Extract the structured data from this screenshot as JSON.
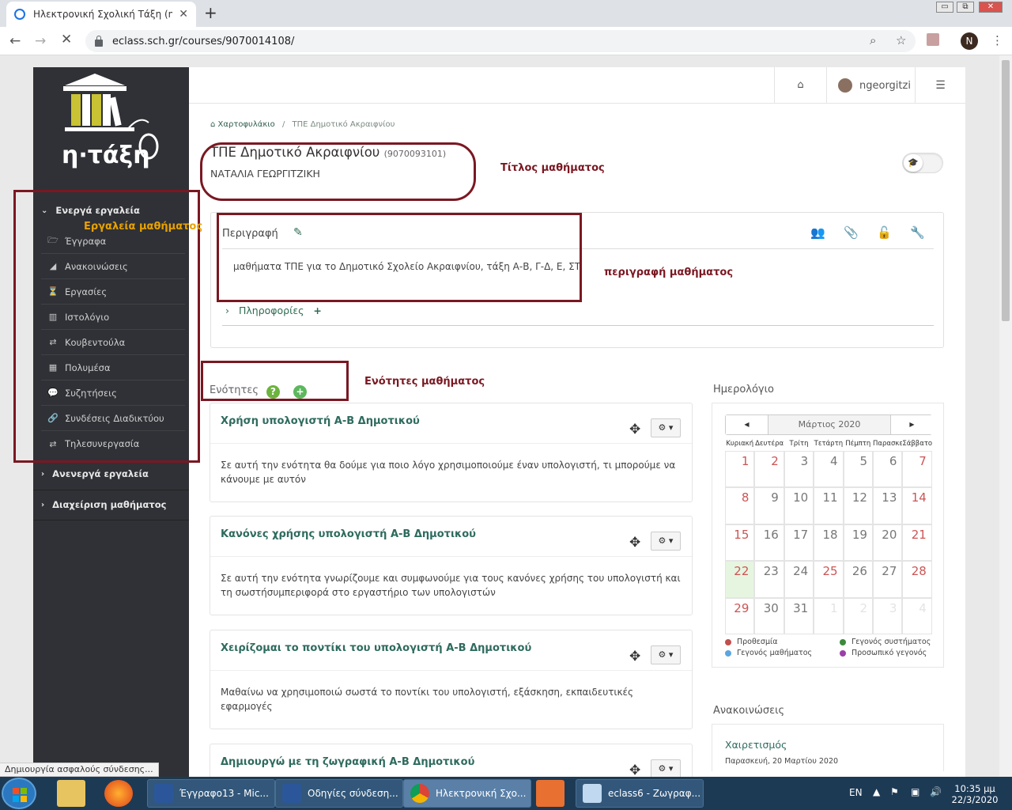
{
  "browser": {
    "tab_title": "Ηλεκτρονική Σχολική Τάξη (η-Τά",
    "tab_close": "✕",
    "new_tab": "+",
    "url": "eclass.sch.gr/courses/9070014108/",
    "profile_initial": "N",
    "win_min": "▭",
    "win_max": "⧉",
    "win_close": "✕"
  },
  "sidebar": {
    "logo_text": "η·τάξη",
    "active_group": "Ενεργά εργαλεία",
    "items": [
      {
        "label": "Έγγραφα",
        "icon": "folder-icon"
      },
      {
        "label": "Ανακοινώσεις",
        "icon": "megaphone-icon"
      },
      {
        "label": "Εργασίες",
        "icon": "flask-icon"
      },
      {
        "label": "Ιστολόγιο",
        "icon": "columns-icon"
      },
      {
        "label": "Κουβεντούλα",
        "icon": "exchange-icon"
      },
      {
        "label": "Πολυμέσα",
        "icon": "film-icon"
      },
      {
        "label": "Συζητήσεις",
        "icon": "comments-icon"
      },
      {
        "label": "Συνδέσεις Διαδικτύου",
        "icon": "link-icon"
      },
      {
        "label": "Τηλεσυνεργασία",
        "icon": "exchange-icon"
      }
    ],
    "inactive_group": "Ανενεργά εργαλεία",
    "manage_group": "Διαχείριση μαθήματος"
  },
  "topbar": {
    "username": "ngeorgitzi"
  },
  "breadcrumb": {
    "home": "Χαρτοφυλάκιο",
    "separator": "/",
    "current": "ΤΠΕ Δημοτικό Ακραιφνίου"
  },
  "course": {
    "title": "ΤΠΕ Δημοτικό Ακραιφνίου",
    "code": "(9070093101)",
    "teacher": "ΝΑΤΑΛΙΑ ΓΕΩΡΓΙΤΖΙΚΗ",
    "description_label": "Περιγραφή",
    "description": "μαθήματα ΤΠΕ για το Δημοτικό Σχολείο Ακραιφνίου, τάξη Α-Β, Γ-Δ, Ε, ΣΤ",
    "info_link": "Πληροφορίες"
  },
  "units": {
    "label": "Ενότητες",
    "items": [
      {
        "title": "Χρήση υπολογιστή Α-Β Δημοτικού",
        "desc": "Σε αυτή την ενότητα θα δούμε για ποιο λόγο χρησιμοποιούμε έναν υπολογιστή, τι μπορούμε να κάνουμε με αυτόν"
      },
      {
        "title": "Κανόνες χρήσης υπολογιστή Α-Β Δημοτικού",
        "desc": "Σε αυτή την ενότητα γνωρίζουμε και συμφωνούμε για τους κανόνες χρήσης του υπολογιστή και τη σωστήσυμπεριφορά στο εργαστήριο των υπολογιστών"
      },
      {
        "title": "Χειρίζομαι το ποντίκι του υπολογιστή Α-Β Δημοτικού",
        "desc": "Μαθαίνω να χρησιμοποιώ σωστά το ποντίκι του υπολογιστή, εξάσκηση, εκπαιδευτικές εφαρμογές"
      },
      {
        "title": "Δημιουργώ με τη ζωγραφική Α-Β Δημοτικού",
        "desc": ""
      }
    ]
  },
  "calendar": {
    "heading": "Ημερολόγιο",
    "month": "Μάρτιος 2020",
    "prev": "◀",
    "next": "▶",
    "days_of_week": [
      "Κυριακή",
      "Δευτέρα",
      "Τρίτη",
      "Τετάρτη",
      "Πέμπτη",
      "Παρασκευή",
      "Σάββατο"
    ],
    "days": [
      "1",
      "2",
      "3",
      "4",
      "5",
      "6",
      "7",
      "8",
      "9",
      "10",
      "11",
      "12",
      "13",
      "14",
      "15",
      "16",
      "17",
      "18",
      "19",
      "20",
      "21",
      "22",
      "23",
      "24",
      "25",
      "26",
      "27",
      "28",
      "29",
      "30",
      "31",
      "1",
      "2",
      "3",
      "4"
    ],
    "today": "22",
    "legend": [
      {
        "label": "Προθεσμία",
        "color": "#c0504d"
      },
      {
        "label": "Γεγονός συστήματος",
        "color": "#3c8a3c"
      },
      {
        "label": "Γεγονός μαθήματος",
        "color": "#5aa6e0"
      },
      {
        "label": "Προσωπικό γεγονός",
        "color": "#9b3fa8"
      }
    ]
  },
  "announcements": {
    "heading": "Ανακοινώσεις",
    "items": [
      {
        "title": "Χαιρετισμός",
        "date": "Παρασκευή, 20 Μαρτίου 2020"
      }
    ]
  },
  "annotations": {
    "course_title": "Τίτλος μαθήματος",
    "course_tools": "Εργαλεία μαθήματος",
    "course_description": "περιγραφή μαθήματος",
    "course_units": "Ενότητες μαθήματος"
  },
  "status_bar": "Δημιουργία ασφαλούς σύνδεσης...",
  "taskbar": {
    "buttons": [
      {
        "label": "Έγγραφο13 - Mic...",
        "icon": "word-icon"
      },
      {
        "label": "Οδηγίες σύνδεση...",
        "icon": "word-icon"
      },
      {
        "label": "Ηλεκτρονική Σχο...",
        "icon": "chrome-icon"
      },
      {
        "label": "eclass6 - Ζωγραφ...",
        "icon": "paint-icon"
      }
    ],
    "lang": "EN",
    "time": "10:35 μμ",
    "date": "22/3/2020"
  },
  "colors": {
    "sidebar_bg": "#2f3136",
    "accent_green": "#2e6b5e",
    "annotation_red": "#7a1822",
    "annotation_yellow": "#e8a200"
  }
}
